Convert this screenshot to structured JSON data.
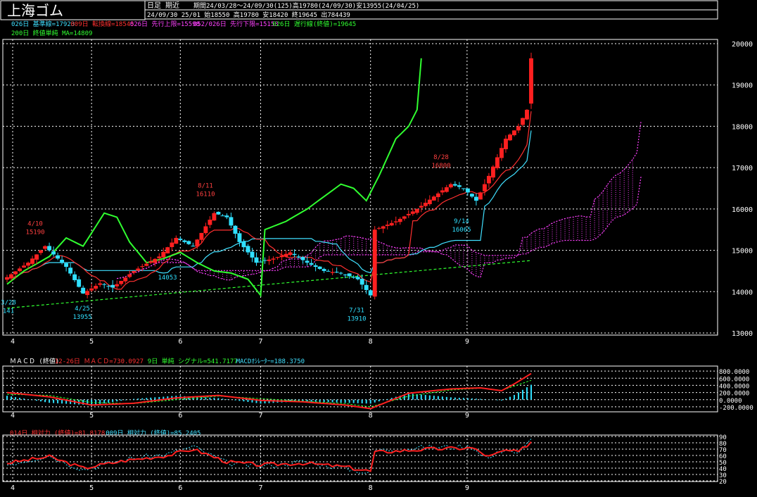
{
  "header": {
    "title": "上海ゴム",
    "mode": "日足 期近",
    "period": "期間24/03/28～24/09/30(125)高19780(24/09/30)安13955(24/04/25)",
    "latest": "24/09/30 25/01 始18550 高19780 安18420 終19645 出784439"
  },
  "legend_main": [
    {
      "text": "026日 基準線=17923",
      "color": "#40e0ff"
    },
    {
      "text": "009日 転換線=18545",
      "color": "#ff3030"
    },
    {
      "text": "026日 先行上限=15598",
      "color": "#ff40ff"
    },
    {
      "text": "052/026日 先行下限=15153",
      "color": "#ff40ff"
    },
    {
      "text": "026日 遅行線(終値)=19645",
      "color": "#30ff30"
    }
  ],
  "legend_main2": [
    {
      "text": "200日 終値単純 MA=14809",
      "color": "#30ff30"
    }
  ],
  "macd_legend": [
    {
      "text": "ＭＡＣＤ (終値)",
      "color": "#ffffff"
    },
    {
      "text": "12-26日 ＭＡＣＤ=730.0927",
      "color": "#ff3030"
    },
    {
      "text": "9日 単純 シグナル=541.7177",
      "color": "#30ff30"
    },
    {
      "text": "MACDｵｼﾚｰﾀｰ=188.3750",
      "color": "#40e0ff"
    }
  ],
  "rsi_legend": [
    {
      "text": "014日 相対力 (終値)=81.8178",
      "color": "#ff3030"
    },
    {
      "text": "009日 相対力 (終値)=85.2405",
      "color": "#40e0ff"
    }
  ],
  "colors": {
    "bg": "#000000",
    "grid": "#ffffff",
    "up": "#ff2020",
    "down": "#30e0ff",
    "kijun": "#40e0ff",
    "tenkan": "#ff3030",
    "span": "#ff40ff",
    "chikou": "#30ff30",
    "ma": "#30ff30"
  },
  "chart_data": [
    {
      "type": "candlestick",
      "ylim": [
        13000,
        20000
      ],
      "yticks": [
        "20000",
        "19000",
        "18000",
        "17000",
        "16000",
        "15000",
        "14000",
        "13000"
      ],
      "xticks": [
        "4",
        "5",
        "6",
        "7",
        "8",
        "9"
      ],
      "annotations": [
        {
          "date": "4/10",
          "value": "15190",
          "label": "4/10",
          "sub": "15190"
        },
        {
          "date": "4/25",
          "value": "13955",
          "label": "4/25",
          "sub": "13955"
        },
        {
          "date": "8/11",
          "value": "16110",
          "label": "8/11",
          "sub": "16110"
        },
        {
          "date": "7/31",
          "value": "13910",
          "label": "7/31",
          "sub": "13910"
        },
        {
          "date": "8/28",
          "value": "16800",
          "label": "8/28",
          "sub": "16800"
        },
        {
          "date": "9/14",
          "value": "16065",
          "label": "9/14",
          "sub": "16065"
        },
        {
          "date": "3/28",
          "value": "14100",
          "label": "3/28",
          "sub": "141"
        }
      ],
      "extra_label": "14053",
      "anchors": [
        [
          0,
          14350
        ],
        [
          5,
          14700
        ],
        [
          9,
          15100
        ],
        [
          14,
          14600
        ],
        [
          18,
          13955
        ],
        [
          22,
          14200
        ],
        [
          25,
          14100
        ],
        [
          30,
          14500
        ],
        [
          36,
          14850
        ],
        [
          40,
          15300
        ],
        [
          44,
          15100
        ],
        [
          49,
          15900
        ],
        [
          52,
          15800
        ],
        [
          55,
          15200
        ],
        [
          59,
          14700
        ],
        [
          63,
          14800
        ],
        [
          67,
          14950
        ],
        [
          71,
          14700
        ],
        [
          75,
          14500
        ],
        [
          79,
          14450
        ],
        [
          83,
          14300
        ],
        [
          86,
          13910
        ],
        [
          87,
          15500
        ],
        [
          92,
          15700
        ],
        [
          97,
          16000
        ],
        [
          101,
          16300
        ],
        [
          105,
          16600
        ],
        [
          108,
          16500
        ],
        [
          111,
          16200
        ],
        [
          114,
          16800
        ],
        [
          118,
          17700
        ],
        [
          121,
          18000
        ],
        [
          123,
          18400
        ],
        [
          124,
          19645
        ]
      ]
    },
    {
      "type": "line",
      "name": "MACD",
      "ylim": [
        -300,
        900
      ],
      "yticks": [
        "800.0000",
        "600.0000",
        "400.0000",
        "200.0000",
        "0.0000",
        "-200.0000"
      ],
      "macd_anchors": [
        [
          0,
          200
        ],
        [
          10,
          80
        ],
        [
          20,
          -150
        ],
        [
          30,
          -100
        ],
        [
          40,
          50
        ],
        [
          50,
          120
        ],
        [
          60,
          -20
        ],
        [
          70,
          -60
        ],
        [
          80,
          -150
        ],
        [
          86,
          -250
        ],
        [
          95,
          180
        ],
        [
          105,
          300
        ],
        [
          112,
          330
        ],
        [
          117,
          250
        ],
        [
          120,
          440
        ],
        [
          124,
          730
        ]
      ],
      "signal_anchors": [
        [
          0,
          150
        ],
        [
          10,
          120
        ],
        [
          20,
          -80
        ],
        [
          30,
          -110
        ],
        [
          40,
          0
        ],
        [
          50,
          100
        ],
        [
          60,
          30
        ],
        [
          70,
          -40
        ],
        [
          80,
          -110
        ],
        [
          86,
          -200
        ],
        [
          95,
          100
        ],
        [
          105,
          270
        ],
        [
          112,
          320
        ],
        [
          117,
          260
        ],
        [
          120,
          380
        ],
        [
          124,
          540
        ]
      ]
    },
    {
      "type": "line",
      "name": "RSI",
      "ylim": [
        20,
        90
      ],
      "yticks": [
        "90",
        "80",
        "70",
        "60",
        "50",
        "40",
        "30",
        "20"
      ],
      "rsi14_anchors": [
        [
          0,
          48
        ],
        [
          10,
          58
        ],
        [
          18,
          40
        ],
        [
          28,
          52
        ],
        [
          38,
          60
        ],
        [
          44,
          70
        ],
        [
          52,
          50
        ],
        [
          60,
          45
        ],
        [
          70,
          48
        ],
        [
          80,
          42
        ],
        [
          86,
          35
        ],
        [
          87,
          65
        ],
        [
          100,
          70
        ],
        [
          110,
          72
        ],
        [
          114,
          58
        ],
        [
          118,
          68
        ],
        [
          121,
          65
        ],
        [
          124,
          82
        ]
      ],
      "rsi9_anchors": [
        [
          0,
          46
        ],
        [
          10,
          60
        ],
        [
          18,
          38
        ],
        [
          28,
          54
        ],
        [
          38,
          62
        ],
        [
          44,
          74
        ],
        [
          52,
          48
        ],
        [
          60,
          43
        ],
        [
          70,
          50
        ],
        [
          80,
          40
        ],
        [
          86,
          32
        ],
        [
          87,
          68
        ],
        [
          100,
          73
        ],
        [
          110,
          74
        ],
        [
          114,
          55
        ],
        [
          118,
          72
        ],
        [
          121,
          62
        ],
        [
          124,
          85
        ]
      ]
    }
  ]
}
